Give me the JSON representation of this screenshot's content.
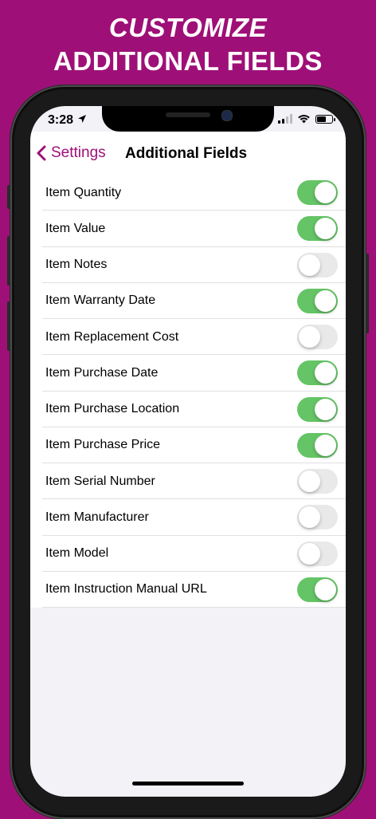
{
  "headline": {
    "line1": "CUSTOMIZE",
    "line2": "ADDITIONAL FIELDS"
  },
  "status_bar": {
    "time": "3:28"
  },
  "nav": {
    "back_label": "Settings",
    "title": "Additional Fields"
  },
  "fields": [
    {
      "label": "Item Quantity",
      "enabled": true
    },
    {
      "label": "Item Value",
      "enabled": true
    },
    {
      "label": "Item Notes",
      "enabled": false
    },
    {
      "label": "Item Warranty Date",
      "enabled": true
    },
    {
      "label": "Item Replacement Cost",
      "enabled": false
    },
    {
      "label": "Item Purchase Date",
      "enabled": true
    },
    {
      "label": "Item Purchase Location",
      "enabled": true
    },
    {
      "label": "Item Purchase Price",
      "enabled": true
    },
    {
      "label": "Item Serial Number",
      "enabled": false
    },
    {
      "label": "Item Manufacturer",
      "enabled": false
    },
    {
      "label": "Item Model",
      "enabled": false
    },
    {
      "label": "Item Instruction Manual URL",
      "enabled": true
    }
  ],
  "colors": {
    "background": "#9E1077",
    "accent": "#9E1077",
    "toggle_on": "#65C466",
    "toggle_off": "#E9E9EA"
  }
}
